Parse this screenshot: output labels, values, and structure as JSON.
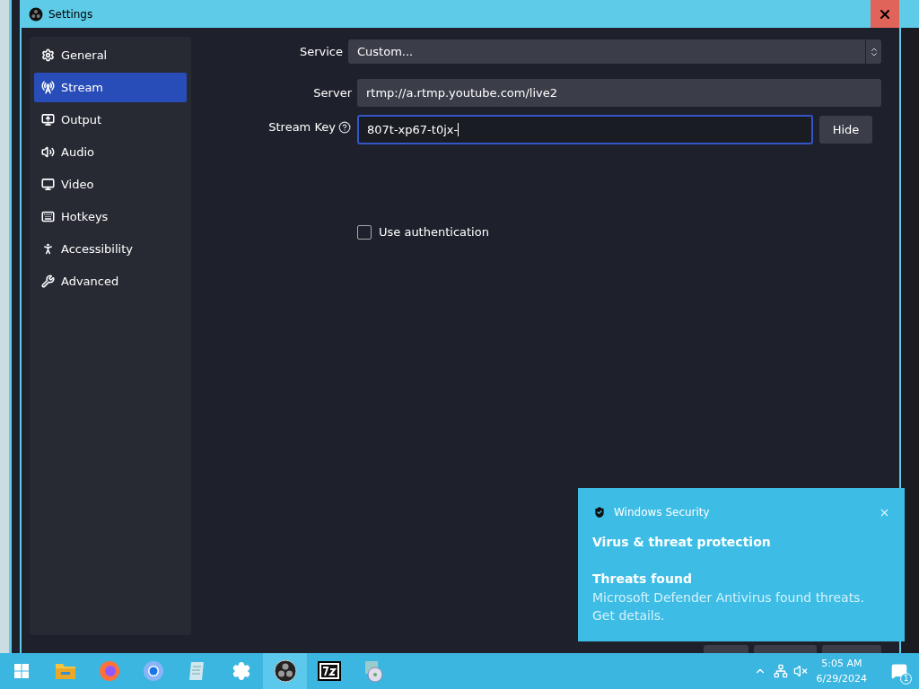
{
  "window": {
    "title": "Settings"
  },
  "sidebar": {
    "items": [
      {
        "label": "General",
        "selected": false
      },
      {
        "label": "Stream",
        "selected": true
      },
      {
        "label": "Output",
        "selected": false
      },
      {
        "label": "Audio",
        "selected": false
      },
      {
        "label": "Video",
        "selected": false
      },
      {
        "label": "Hotkeys",
        "selected": false
      },
      {
        "label": "Accessibility",
        "selected": false
      },
      {
        "label": "Advanced",
        "selected": false
      }
    ]
  },
  "form": {
    "service": {
      "label": "Service",
      "value": "Custom..."
    },
    "server": {
      "label": "Server",
      "value": "rtmp://a.rtmp.youtube.com/live2"
    },
    "stream_key": {
      "label": "Stream Key",
      "value": "807t-xp67-t0jx-",
      "focused": true
    },
    "hide_button": "Hide",
    "use_authentication": {
      "label": "Use authentication",
      "checked": false
    }
  },
  "notification": {
    "app": "Windows Security",
    "title": "Virus & threat protection",
    "subtitle": "Threats found",
    "body": "Microsoft Defender Antivirus found threats. Get details."
  },
  "taskbar": {
    "apps": [
      {
        "kind": "files",
        "active": false
      },
      {
        "kind": "firefox",
        "active": false
      },
      {
        "kind": "chrome",
        "active": false
      },
      {
        "kind": "notepad",
        "active": false
      },
      {
        "kind": "settings",
        "active": false
      },
      {
        "kind": "obs",
        "active": true
      },
      {
        "kind": "sevenzip",
        "active": false
      },
      {
        "kind": "installer",
        "active": false
      }
    ],
    "time": "5:05 AM",
    "date": "6/29/2024",
    "notification_count": "1"
  }
}
